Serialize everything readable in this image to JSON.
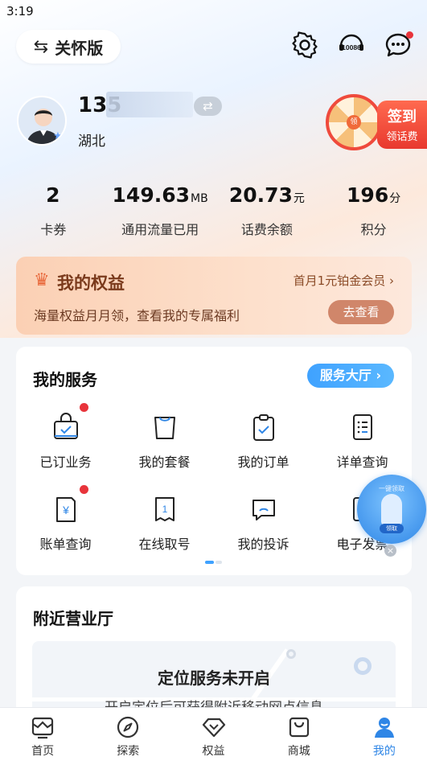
{
  "status_bar": {
    "time": "3:19"
  },
  "header": {
    "care_mode_label": "关怀版",
    "icons": [
      "settings-icon",
      "customer-service-10086-icon",
      "message-icon"
    ],
    "service_badge": "10086"
  },
  "profile": {
    "phone_prefix": "135",
    "region": "湖北",
    "signin": {
      "wheel_center": "领",
      "title": "签到",
      "subtitle": "领话费"
    }
  },
  "stats": [
    {
      "value": "2",
      "unit": "",
      "label": "卡券"
    },
    {
      "value": "149.63",
      "unit": "MB",
      "label": "通用流量已用"
    },
    {
      "value": "20.73",
      "unit": "元",
      "label": "话费余额"
    },
    {
      "value": "196",
      "unit": "分",
      "label": "积分"
    }
  ],
  "benefits": {
    "title": "我的权益",
    "promo": "首月1元铂金会员",
    "promo_arrow": "›",
    "description": "海量权益月月领，查看我的专属福利",
    "button": "去查看"
  },
  "services": {
    "title": "我的服务",
    "hall_button": "服务大厅",
    "hall_arrow": "›",
    "items": [
      {
        "label": "已订业务",
        "icon": "subscribed-business-icon",
        "dot": true
      },
      {
        "label": "我的套餐",
        "icon": "package-bag-icon",
        "dot": false
      },
      {
        "label": "我的订单",
        "icon": "order-clipboard-icon",
        "dot": false
      },
      {
        "label": "详单查询",
        "icon": "detail-list-icon",
        "dot": false
      },
      {
        "label": "账单查询",
        "icon": "bill-yuan-icon",
        "dot": true
      },
      {
        "label": "在线取号",
        "icon": "queue-ticket-icon",
        "dot": false
      },
      {
        "label": "我的投诉",
        "icon": "complaint-chat-icon",
        "dot": false
      },
      {
        "label": "电子发票",
        "icon": "e-invoice-icon",
        "dot": false
      }
    ],
    "float_ball": {
      "top_text": "一键领取",
      "tag": "领取"
    }
  },
  "nearby": {
    "title": "附近营业厅",
    "map_message": "定位服务未开启",
    "map_sub": "开启定位后可获得附近移动网点信息"
  },
  "tabbar": [
    {
      "label": "首页",
      "icon": "home-icon",
      "active": false
    },
    {
      "label": "探索",
      "icon": "compass-icon",
      "active": false
    },
    {
      "label": "权益",
      "icon": "diamond-icon",
      "active": false
    },
    {
      "label": "商城",
      "icon": "shopping-bag-icon",
      "active": false
    },
    {
      "label": "我的",
      "icon": "profile-icon",
      "active": true
    }
  ],
  "colors": {
    "accent_blue": "#2f86e6",
    "badge_red": "#e8343b",
    "benefit_brown": "#7a3a1c"
  }
}
